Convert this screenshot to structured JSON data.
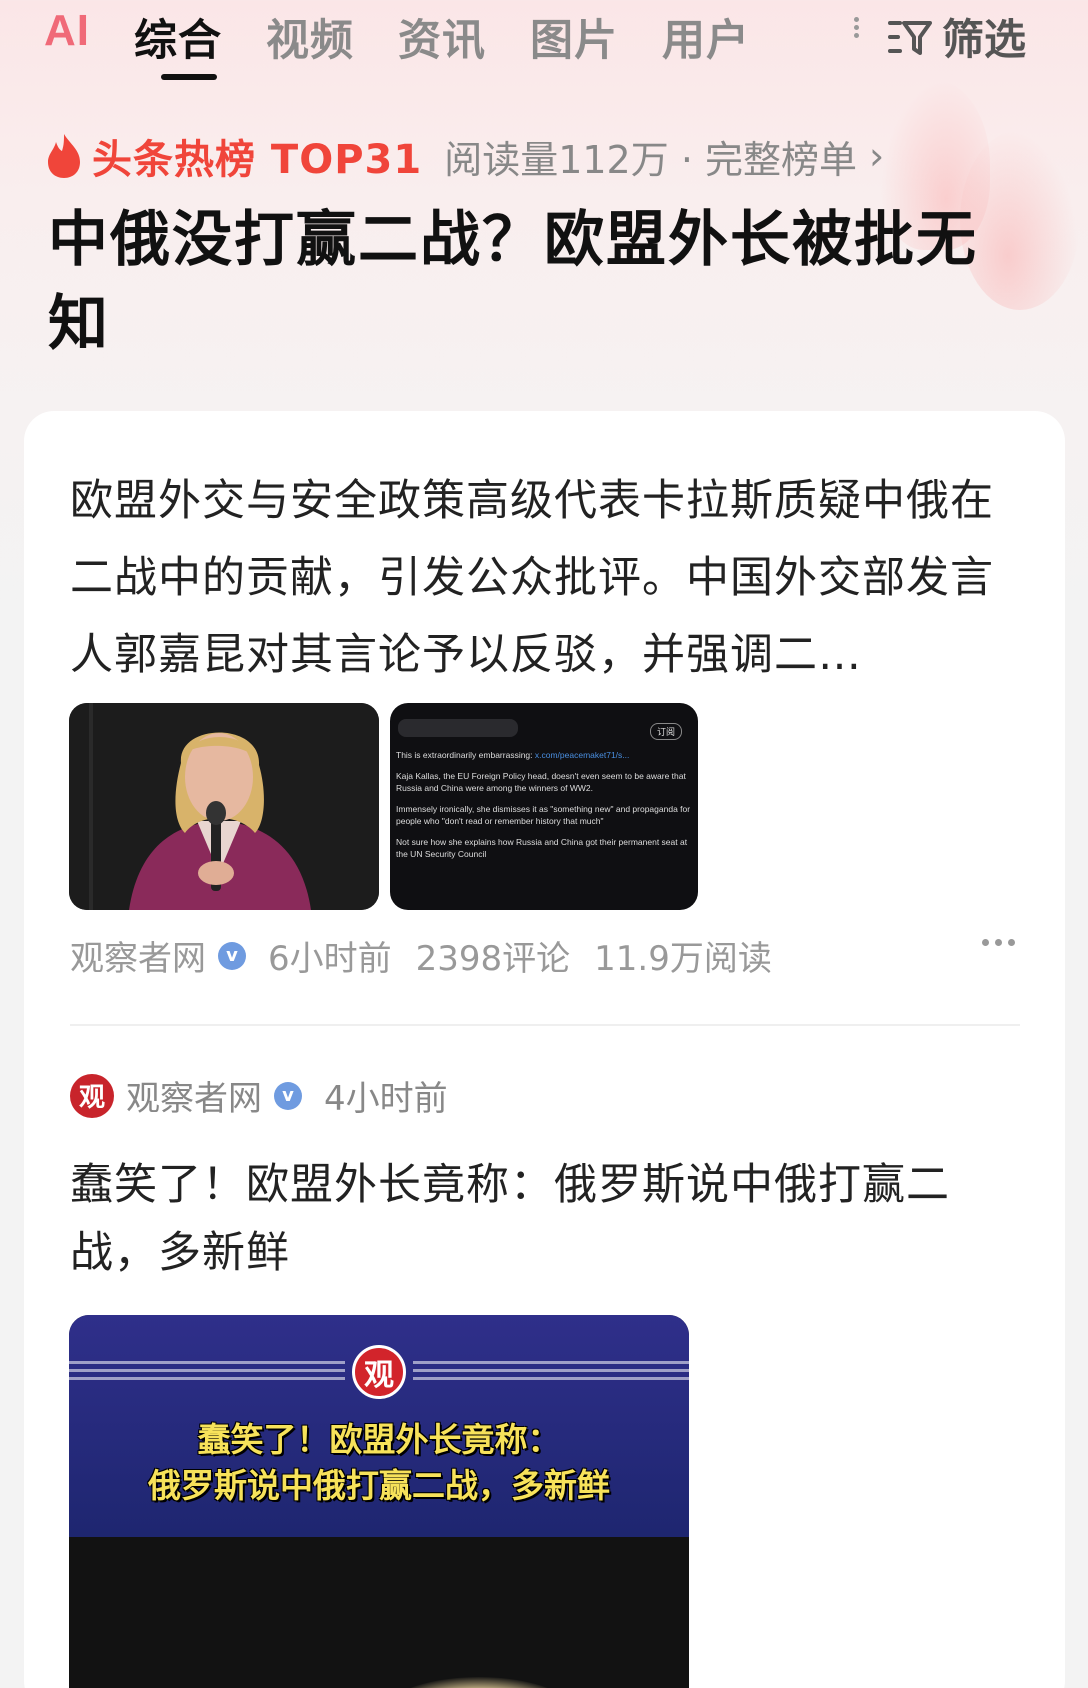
{
  "tabs": {
    "ai": "AI",
    "items": [
      "综合",
      "视频",
      "资讯",
      "图片",
      "用户"
    ],
    "filter": "筛选"
  },
  "hot": {
    "label": "头条热榜 TOP31",
    "meta": "阅读量112万 · 完整榜单",
    "chevron": "›"
  },
  "headline": "中俄没打赢二战？欧盟外长被批无知",
  "article1": {
    "summary": "欧盟外交与安全政策高级代表卡拉斯质疑中俄在二战中的贡献，引发公众批评。中国外交部发言人郭嘉昆对其言论予以反驳，并强调二…",
    "tweet": {
      "subscribe": "订阅",
      "line1_prefix": "This is extraordinarily embarrassing: ",
      "line1_link": "x.com/peacemaket71/s...",
      "line2": "Kaja Kallas, the EU Foreign Policy head, doesn't even seem to be aware that Russia and China were among the winners of WW2.",
      "line3": "Immensely ironically, she dismisses it as \"something new\" and propaganda for people who \"don't read or remember history that much\"",
      "line4": "Not sure how she explains how Russia and China got their permanent seat at the UN Security Council"
    },
    "source": "观察者网",
    "verified": "v",
    "time": "6小时前",
    "comments": "2398评论",
    "reads": "11.9万阅读"
  },
  "article2": {
    "avatar": "观",
    "source": "观察者网",
    "verified": "v",
    "time": "4小时前",
    "title": "蠢笑了！欧盟外长竟称：俄罗斯说中俄打赢二战，多新鲜",
    "video_logo": "观",
    "video_line1": "蠢笑了！欧盟外长竟称：",
    "video_line2": "俄罗斯说中俄打赢二战，多新鲜"
  }
}
